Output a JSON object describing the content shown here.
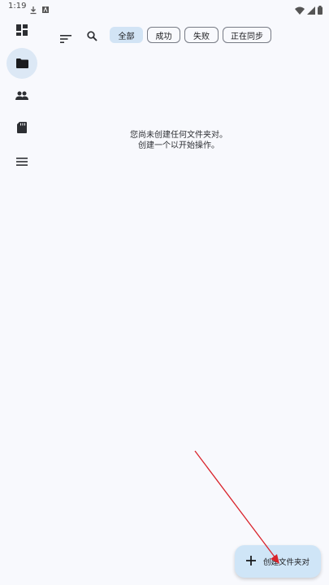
{
  "status_bar": {
    "time": "1:19",
    "icons": [
      "download-icon",
      "font-icon",
      "wifi-icon",
      "signal-icon",
      "battery-icon"
    ]
  },
  "rail": {
    "items": [
      {
        "name": "dashboard-icon",
        "active": false
      },
      {
        "name": "folder-icon",
        "active": true
      },
      {
        "name": "people-icon",
        "active": false
      },
      {
        "name": "sd-card-icon",
        "active": false
      },
      {
        "name": "menu-icon",
        "active": false
      }
    ]
  },
  "toolbar": {
    "sort_icon": "sort-icon",
    "search_icon": "search-icon"
  },
  "filters": [
    {
      "label": "全部",
      "selected": true
    },
    {
      "label": "成功",
      "selected": false
    },
    {
      "label": "失败",
      "selected": false
    },
    {
      "label": "正在同步",
      "selected": false
    }
  ],
  "empty_state": {
    "line1": "您尚未创建任何文件夹对。",
    "line2": "创建一个以开始操作。"
  },
  "fab": {
    "icon": "plus-icon",
    "label": "创建文件夹对"
  },
  "colors": {
    "background": "#f8f9fd",
    "accent_chip": "#d2e4f5",
    "fab_bg": "#cfe5f7",
    "annotation_arrow": "#d9232b"
  }
}
